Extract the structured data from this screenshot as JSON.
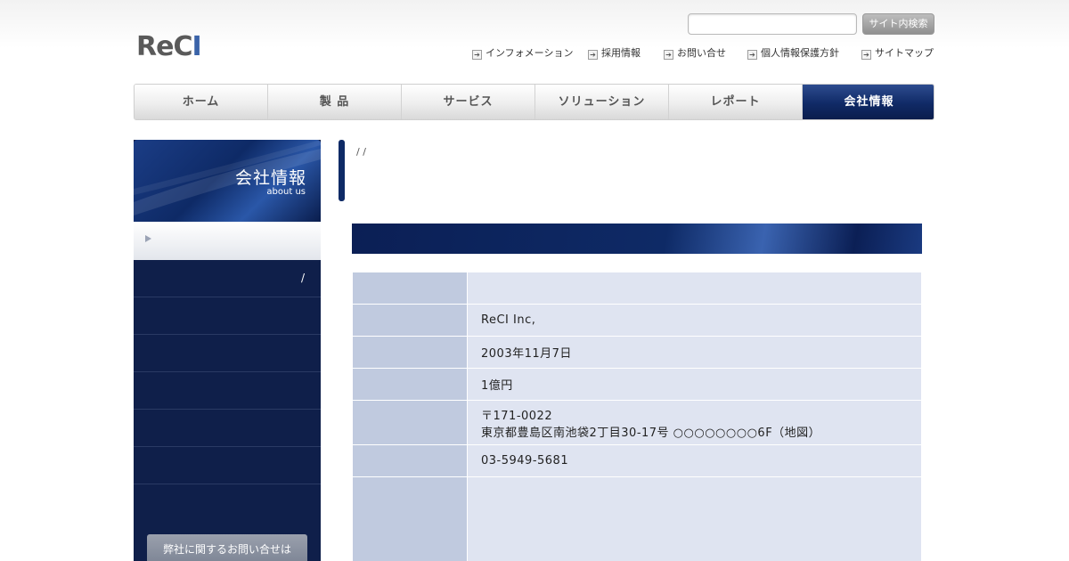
{
  "header": {
    "logo_main": "ReC",
    "logo_accent": "I",
    "search": {
      "placeholder": "",
      "button_label": "サイト内検索"
    },
    "utility_links": [
      "インフォメーション",
      "採用情報",
      "お問い合せ",
      "個人情報保護方針",
      "サイトマップ"
    ]
  },
  "global_nav": {
    "items": [
      "ホーム",
      "製 品",
      "サービス",
      "ソリューション",
      "レポート",
      "会社情報"
    ],
    "active_index": 5
  },
  "sidebar": {
    "title": "会社情報",
    "subtitle": "about us",
    "items": [
      "",
      "/",
      "",
      "",
      "",
      "",
      ""
    ],
    "contact_label": "弊社に関するお問い合せは"
  },
  "main": {
    "breadcrumb": [
      "",
      ""
    ],
    "breadcrumb_sep": "/",
    "page_title": "",
    "section_title": "",
    "table": [
      {
        "label": "",
        "value": ""
      },
      {
        "label": "",
        "value": "ReCI Inc,"
      },
      {
        "label": "",
        "value": "2003年11月7日"
      },
      {
        "label": "",
        "value": "1億円"
      },
      {
        "label": "",
        "value_lines": [
          "〒171-0022",
          "東京都豊島区南池袋2丁目30-17号 ○○○○○○○○6F（地図）"
        ]
      },
      {
        "label": "",
        "value": "03-5949-5681"
      },
      {
        "label": "",
        "officers": [
          {
            "role": "",
            "name": ""
          },
          {
            "role": "",
            "name": ""
          },
          {
            "role": "",
            "name": ""
          },
          {
            "role": "",
            "name": ""
          },
          {
            "role": "",
            "name": ""
          }
        ]
      }
    ]
  },
  "colors": {
    "navy": "#0e2a66",
    "sidebar_bg": "#0f1f4a",
    "table_label_bg": "#c0cadf",
    "table_value_bg": "#dfe4f1",
    "logo_accent": "#3a63a8"
  }
}
